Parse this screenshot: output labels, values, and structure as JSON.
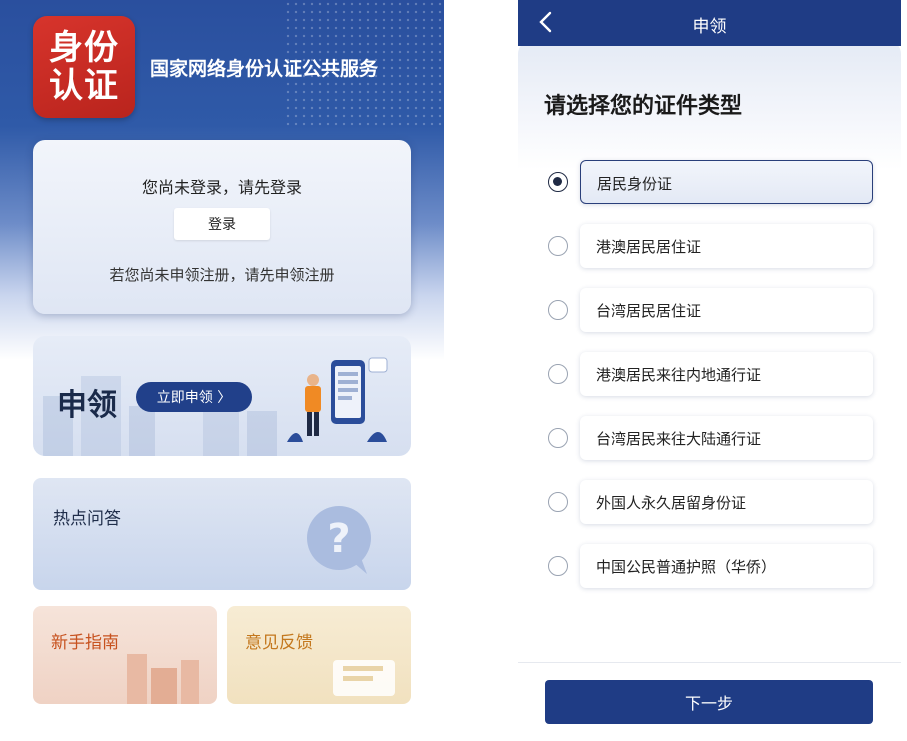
{
  "left_screen": {
    "logo": {
      "line1": "身份",
      "line2": "认证"
    },
    "app_title": "国家网络身份认证公共服务",
    "login_card": {
      "tip": "您尚未登录，请先登录",
      "login_button": "登录",
      "register_tip": "若您尚未申领注册，请先申领注册"
    },
    "apply_card": {
      "title": "申领",
      "button": "立即申领 〉"
    },
    "hot_qa": {
      "title": "热点问答"
    },
    "guide": {
      "title": "新手指南"
    },
    "feedback": {
      "title": "意见反馈"
    }
  },
  "right_screen": {
    "nav": {
      "back_icon": "chevron-left-icon",
      "title": "申领"
    },
    "heading": "请选择您的证件类型",
    "options": [
      {
        "label": "居民身份证",
        "selected": true
      },
      {
        "label": "港澳居民居住证",
        "selected": false
      },
      {
        "label": "台湾居民居住证",
        "selected": false
      },
      {
        "label": "港澳居民来往内地通行证",
        "selected": false
      },
      {
        "label": "台湾居民来往大陆通行证",
        "selected": false
      },
      {
        "label": "外国人永久居留身份证",
        "selected": false
      },
      {
        "label": "中国公民普通护照（华侨）",
        "selected": false
      }
    ],
    "next_button": "下一步"
  },
  "colors": {
    "primary_navy": "#1f3c85",
    "logo_red": "#c82a23",
    "guide_orange": "#c7521f",
    "feedback_orange": "#c4781e"
  }
}
